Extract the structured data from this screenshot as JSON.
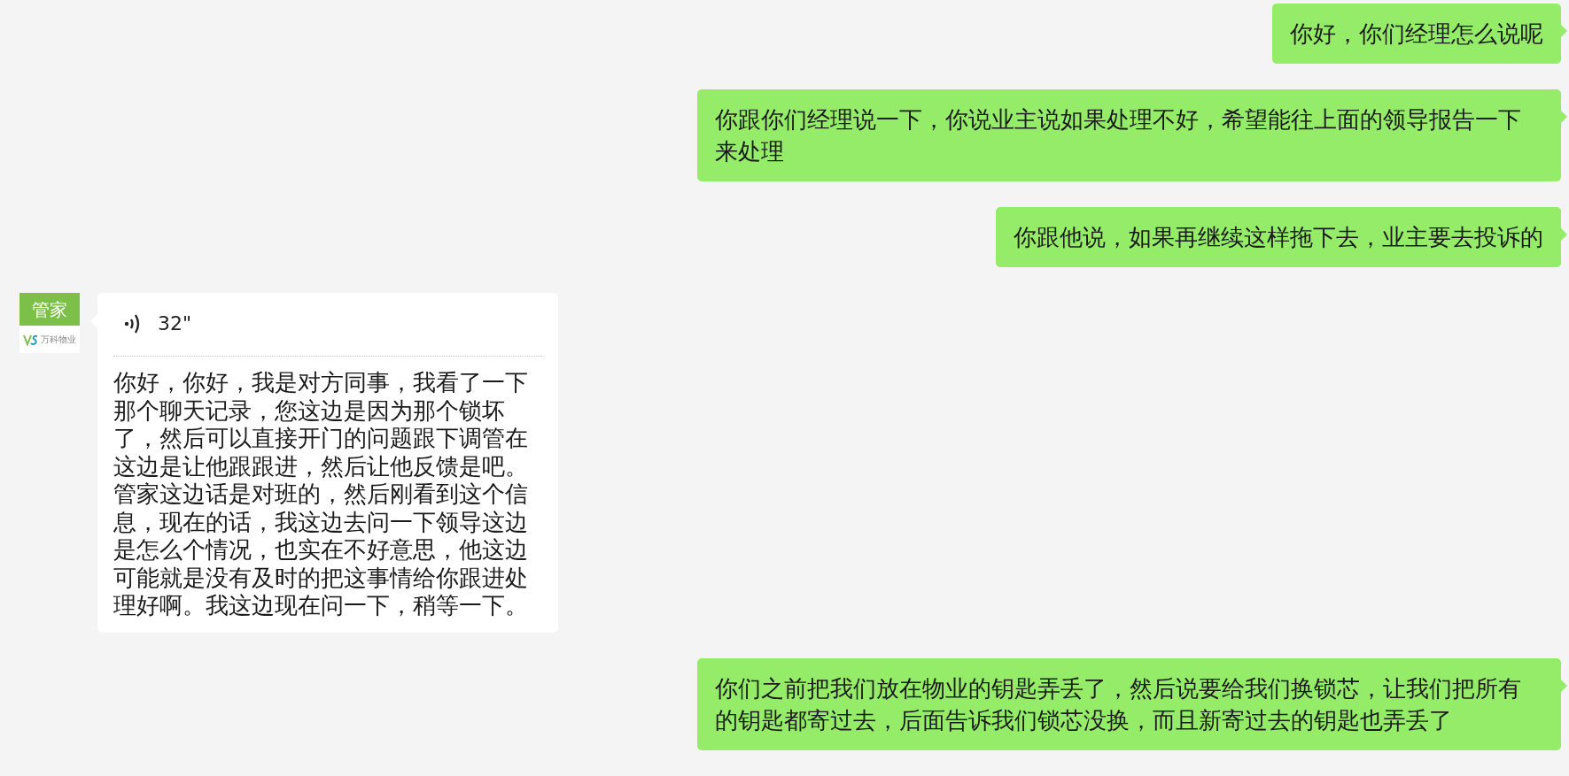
{
  "messages": [
    {
      "kind": "sent_text",
      "text": "你好，你们经理怎么说呢"
    },
    {
      "kind": "sent_text",
      "text": "你跟你们经理说一下，你说业主说如果处理不好，希望能往上面的领导报告一下来处理"
    },
    {
      "kind": "sent_text",
      "text": "你跟他说，如果再继续这样拖下去，业主要去投诉的"
    },
    {
      "kind": "received_voice",
      "avatar": {
        "label": "管家",
        "brand": "万科物业"
      },
      "duration": "32\"",
      "transcript": "你好，你好，我是对方同事，我看了一下那个聊天记录，您这边是因为那个锁坏了，然后可以直接开门的问题跟下调管在这边是让他跟跟进，然后让他反馈是吧。管家这边话是对班的，然后刚看到这个信息，现在的话，我这边去问一下领导这边是怎么个情况，也实在不好意思，他这边可能就是没有及时的把这事情给你跟进处理好啊。我这边现在问一下，稍等一下。"
    },
    {
      "kind": "sent_text",
      "text": "你们之前把我们放在物业的钥匙弄丢了，然后说要给我们换锁芯，让我们把所有的钥匙都寄过去，后面告诉我们锁芯没换，而且新寄过去的钥匙也弄丢了"
    }
  ]
}
